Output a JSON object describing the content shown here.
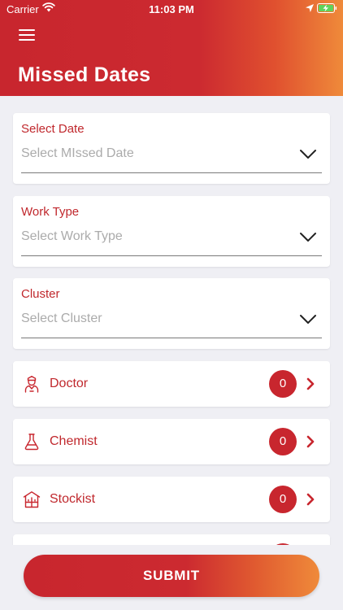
{
  "status_bar": {
    "carrier": "Carrier",
    "time": "11:03 PM"
  },
  "header": {
    "title": "Missed Dates"
  },
  "form": {
    "select_date": {
      "label": "Select Date",
      "placeholder": "Select MIssed Date"
    },
    "work_type": {
      "label": "Work Type",
      "placeholder": "Select Work Type"
    },
    "cluster": {
      "label": "Cluster",
      "placeholder": "Select Cluster"
    }
  },
  "lists": [
    {
      "label": "Doctor",
      "count": "0",
      "icon": "doctor-icon"
    },
    {
      "label": "Chemist",
      "count": "0",
      "icon": "flask-icon"
    },
    {
      "label": "Stockist",
      "count": "0",
      "icon": "warehouse-icon"
    }
  ],
  "submit": {
    "label": "SUBMIT"
  },
  "colors": {
    "primary": "#c8262e",
    "accent": "#ef8a3a",
    "background": "#efeff4"
  }
}
